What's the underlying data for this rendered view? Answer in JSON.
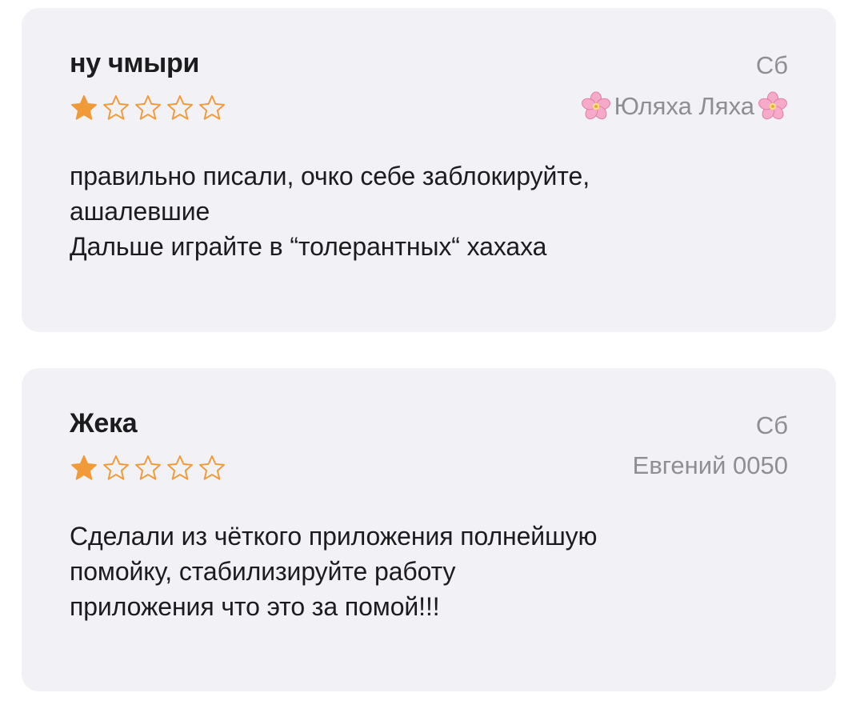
{
  "colors": {
    "card_background": "#f1f1f6",
    "star_color": "#f19a38",
    "secondary_text": "#8e8e93",
    "primary_text": "#1c1c1e"
  },
  "reviews": [
    {
      "title": "ну чмыри",
      "date": "Сб",
      "rating": 1,
      "max_rating": 5,
      "author": "Юляха Ляха",
      "author_decoration_icon": "cherry-blossom-icon",
      "body_lines": [
        "правильно писали, очко себе заблокируйте,",
        "ашалевшие",
        "Дальше играйте в “толерантных“ хахаха"
      ]
    },
    {
      "title": "Жека",
      "date": "Сб",
      "rating": 1,
      "max_rating": 5,
      "author": "Евгений 0050",
      "body_lines": [
        "Сделали из чёткого приложения полнейшую",
        "помойку, стабилизируйте работу",
        "приложения что это за помой!!!"
      ]
    }
  ]
}
